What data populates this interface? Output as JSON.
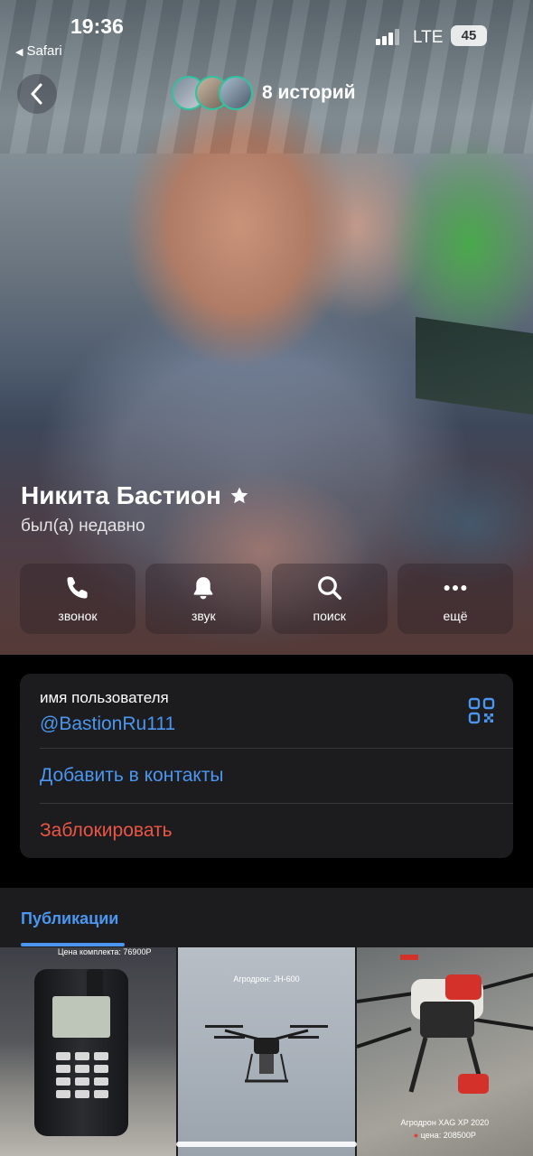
{
  "status_bar": {
    "time": "19:36",
    "back_app": "Safari",
    "network": "LTE",
    "battery": "45"
  },
  "header": {
    "stories_label": "8 историй"
  },
  "profile": {
    "name": "Никита Бастион",
    "status": "был(а) недавно",
    "star_icon": "star-icon"
  },
  "actions": [
    {
      "label": "звонок",
      "icon": "phone-icon"
    },
    {
      "label": "звук",
      "icon": "bell-icon"
    },
    {
      "label": "поиск",
      "icon": "search-icon"
    },
    {
      "label": "ещё",
      "icon": "more-icon"
    }
  ],
  "info": {
    "username_caption": "имя пользователя",
    "username": "@BastionRu111",
    "add_contact": "Добавить в контакты",
    "block": "Заблокировать"
  },
  "publications": {
    "tab_label": "Публикации",
    "tiles": [
      {
        "caption": "Цена комплекта: 76900Р"
      },
      {
        "caption": "Агродрон: JH-600"
      },
      {
        "caption_title": "Агродрон XAG XP 2020",
        "caption_price": "цена: 208500Р"
      }
    ]
  },
  "colors": {
    "accent": "#4a96f0",
    "danger": "#eb5545",
    "card": "#1c1c1e",
    "story_ring": "#2fc4a0"
  }
}
